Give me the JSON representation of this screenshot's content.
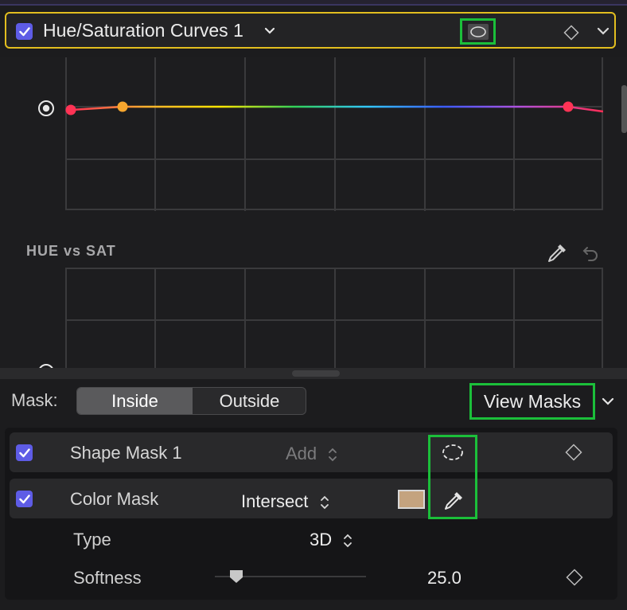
{
  "header": {
    "title": "Hue/Saturation Curves 1",
    "checked": true,
    "icons": [
      "checkbox-icon",
      "chevron-down-icon",
      "mask-shape-icon",
      "keyframe-diamond-icon",
      "collapse-chevron-icon"
    ]
  },
  "graph": {
    "section_label": "HUE vs SAT",
    "curve_colors": [
      "#ff2d55",
      "#ffb02e",
      "#ffe600",
      "#31d158",
      "#33c6ff",
      "#3a5cff",
      "#af52de",
      "#ff2d55"
    ],
    "points_colors": [
      "#ff3355",
      "#f7a62e",
      "#ff3355"
    ]
  },
  "mask_bar": {
    "label": "Mask:",
    "inside": "Inside",
    "outside": "Outside",
    "selected": "Inside",
    "view_masks": "View Masks"
  },
  "masks": [
    {
      "name": "Shape Mask 1",
      "operation": "Add",
      "checked": true,
      "enabled_op": false
    },
    {
      "name": "Color Mask",
      "operation": "Intersect",
      "checked": true,
      "enabled_op": true,
      "swatch_color": "#c4a37f"
    }
  ],
  "properties": {
    "type_label": "Type",
    "type_value": "3D",
    "softness_label": "Softness",
    "softness_value": "25.0",
    "softness_level": 0.14
  },
  "colors": {
    "accent": "#5e5ce6",
    "header_border": "#e2be1f",
    "highlight": "#1bbf3a"
  }
}
